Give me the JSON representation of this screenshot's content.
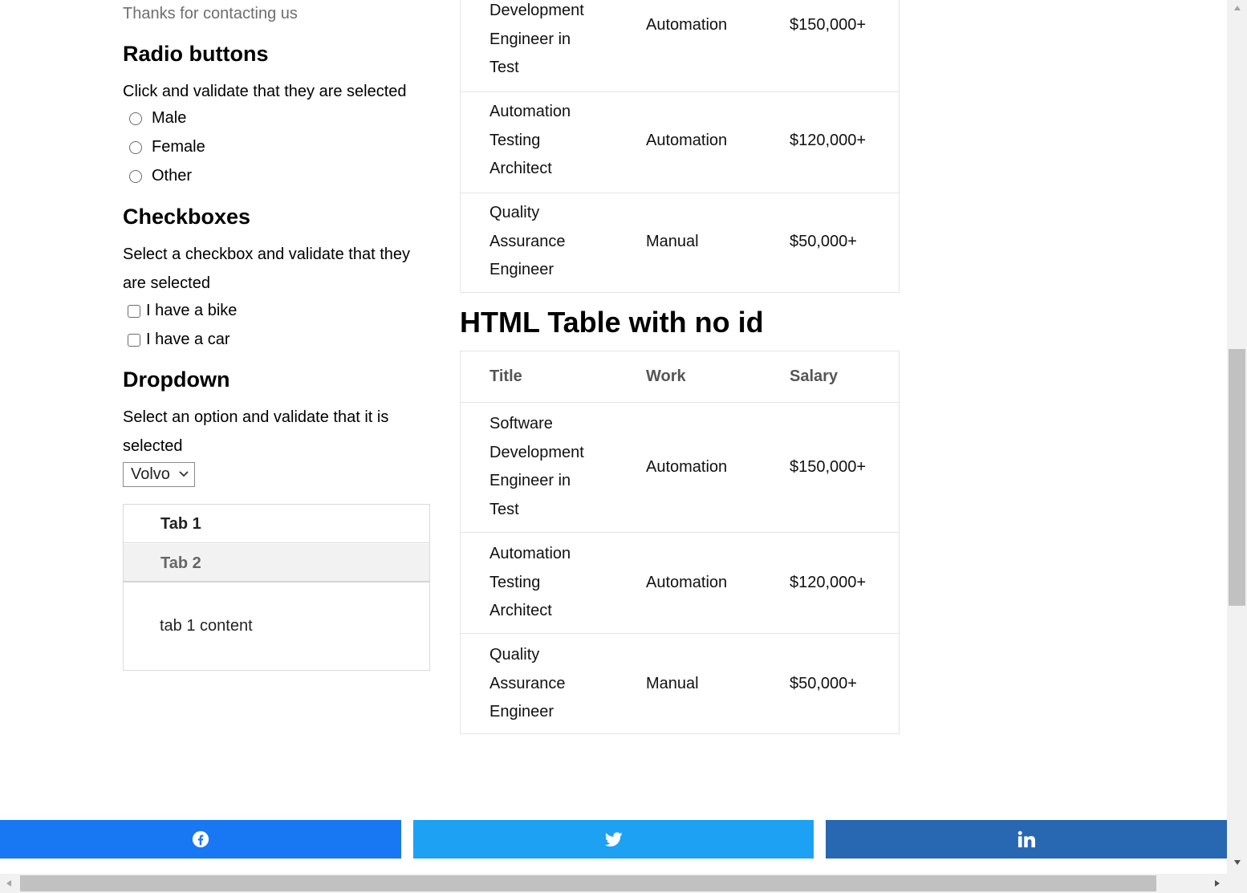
{
  "thanks_text": "Thanks for contacting us",
  "radio": {
    "heading": "Radio buttons",
    "desc": "Click and validate that they are selected",
    "options": [
      "Male",
      "Female",
      "Other"
    ]
  },
  "checkboxes": {
    "heading": "Checkboxes",
    "desc": "Select a checkbox and validate that they are selected",
    "options": [
      "I have a bike",
      "I have a car"
    ]
  },
  "dropdown": {
    "heading": "Dropdown",
    "desc": "Select an option and validate that it is selected",
    "selected": "Volvo"
  },
  "tabs": {
    "labels": [
      "Tab 1",
      "Tab 2"
    ],
    "content": "tab 1 content"
  },
  "table_top": {
    "rows": [
      {
        "title_lines": [
          "Development",
          "Engineer in",
          "Test"
        ],
        "work": "Automation",
        "salary": "$150,000+"
      },
      {
        "title_lines": [
          "Automation",
          "Testing",
          "Architect"
        ],
        "work": "Automation",
        "salary": "$120,000+"
      },
      {
        "title_lines": [
          "Quality",
          "Assurance",
          "Engineer"
        ],
        "work": "Manual",
        "salary": "$50,000+"
      }
    ]
  },
  "table_no_id": {
    "heading": "HTML Table with no id",
    "headers": {
      "title": "Title",
      "work": "Work",
      "salary": "Salary"
    },
    "rows": [
      {
        "title_lines": [
          "Software",
          "Development",
          "Engineer in",
          "Test"
        ],
        "work": "Automation",
        "salary": "$150,000+"
      },
      {
        "title_lines": [
          "Automation",
          "Testing",
          "Architect"
        ],
        "work": "Automation",
        "salary": "$120,000+"
      },
      {
        "title_lines": [
          "Quality",
          "Assurance",
          "Engineer"
        ],
        "work": "Manual",
        "salary": "$50,000+"
      }
    ]
  },
  "share": {
    "icons": [
      "facebook-icon",
      "twitter-icon",
      "linkedin-icon"
    ],
    "colors": {
      "facebook": "#1877f2",
      "twitter": "#1da1f2",
      "linkedin": "#2867b2"
    }
  }
}
